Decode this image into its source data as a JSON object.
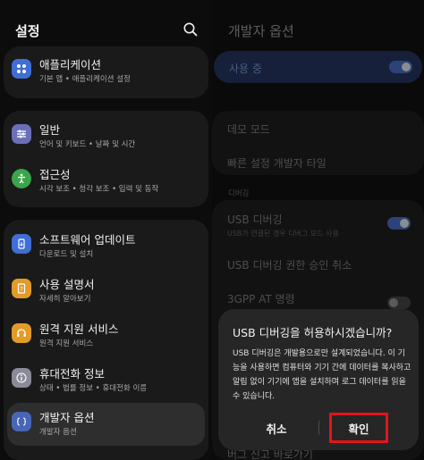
{
  "settings": {
    "title": "설정",
    "items": [
      {
        "label": "애플리케이션",
        "sub": "기본 앱 • 애플리케이션 설정",
        "icon": "apps-icon",
        "color": "#3f6ed4"
      },
      {
        "label": "일반",
        "sub": "언어 및 키보드 • 날짜 및 시간",
        "icon": "sliders-icon",
        "color": "#6a6fb8"
      },
      {
        "label": "접근성",
        "sub": "시각 보조 • 청각 보조 • 입력 및 동작",
        "icon": "accessibility-icon",
        "color": "#3aa54a"
      },
      {
        "label": "소프트웨어 업데이트",
        "sub": "다운로드 및 설치",
        "icon": "update-icon",
        "color": "#3f6ed4"
      },
      {
        "label": "사용 설명서",
        "sub": "자세히 알아보기",
        "icon": "manual-icon",
        "color": "#e39b28"
      },
      {
        "label": "원격 지원 서비스",
        "sub": "원격 지원 서비스",
        "icon": "headset-icon",
        "color": "#e39b28"
      },
      {
        "label": "휴대전화 정보",
        "sub": "상태 • 법률 정보 • 휴대전화 이름",
        "icon": "info-icon",
        "color": "#8a8a99"
      },
      {
        "label": "개발자 옵션",
        "sub": "개발자 옵션",
        "icon": "developer-icon",
        "color": "#4865b8"
      }
    ]
  },
  "developer": {
    "title": "개발자 옵션",
    "in_use_label": "사용 중",
    "demo_mode": "데모 모드",
    "quick_tile": "빠른 설정 개발자 타일",
    "debug_section": "디버깅",
    "usb_debug": "USB 디버깅",
    "usb_debug_sub": "USB가 연결된 경우 디버그 모드 사용",
    "usb_revoke": "USB 디버깅 권한 승인 취소",
    "gpp_cmd": "3GPP AT 명령",
    "bug_report": "버그 신고 바로가기"
  },
  "dialog": {
    "title": "USB 디버깅을 허용하시겠습니까?",
    "body": "USB 디버깅은 개발용으로만 설계되었습니다. 이 기능을 사용하면 컴퓨터와 기기 간에 데이터를 복사하고 알림 없이 기기에 앱을 설치하며 로그 데이터를 읽을 수 있습니다.",
    "cancel": "취소",
    "confirm": "확인"
  },
  "colors": {
    "highlight": "#e3141c",
    "toggle_on": "#2b4377"
  }
}
